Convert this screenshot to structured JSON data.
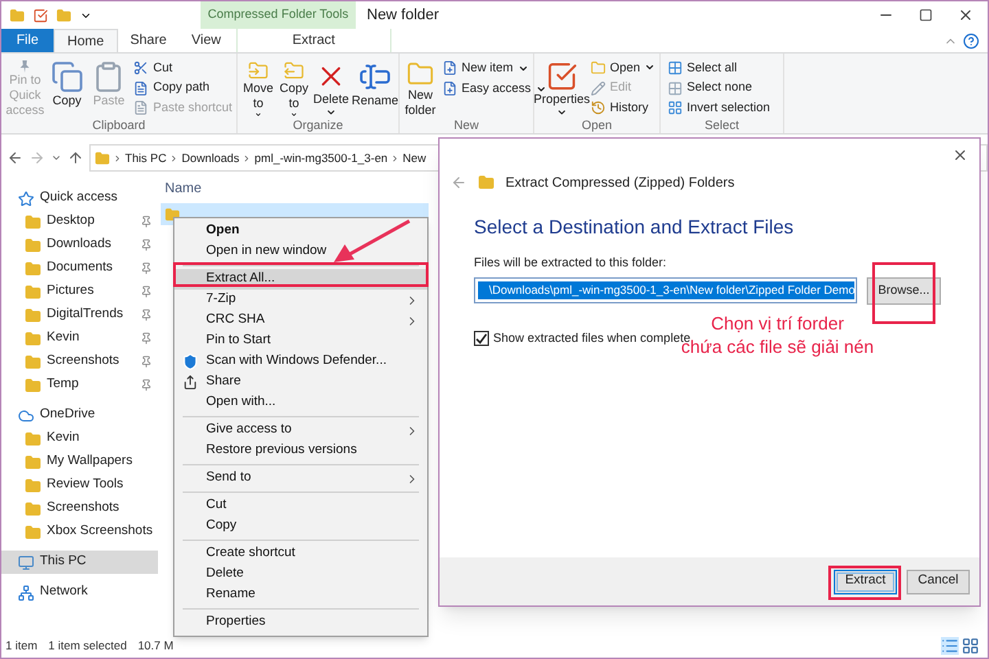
{
  "window": {
    "title": "New folder",
    "context_tab_group": "Compressed Folder Tools"
  },
  "ribbon_tabs": [
    {
      "label": "File",
      "kind": "file",
      "selected": false
    },
    {
      "label": "Home",
      "kind": "tab",
      "selected": true
    },
    {
      "label": "Share",
      "kind": "tab",
      "selected": false
    },
    {
      "label": "View",
      "kind": "tab",
      "selected": false
    },
    {
      "label": "Extract",
      "kind": "context",
      "selected": false
    }
  ],
  "ribbon_groups": [
    {
      "label": "Clipboard",
      "commands": [
        {
          "label": "Pin to Quick access",
          "kind": "large",
          "disabled": true,
          "dropdown": false
        },
        {
          "label": "Copy",
          "kind": "large",
          "disabled": false,
          "dropdown": false
        },
        {
          "label": "Paste",
          "kind": "large",
          "disabled": true,
          "dropdown": false
        },
        {
          "label": "Cut",
          "kind": "small",
          "disabled": false,
          "dropdown": false
        },
        {
          "label": "Copy path",
          "kind": "small",
          "disabled": false,
          "dropdown": false
        },
        {
          "label": "Paste shortcut",
          "kind": "small",
          "disabled": true,
          "dropdown": false
        }
      ]
    },
    {
      "label": "Organize",
      "commands": [
        {
          "label": "Move to",
          "kind": "large",
          "disabled": false,
          "dropdown": true
        },
        {
          "label": "Copy to",
          "kind": "large",
          "disabled": false,
          "dropdown": true
        },
        {
          "label": "Delete",
          "kind": "large",
          "disabled": false,
          "dropdown": true
        },
        {
          "label": "Rename",
          "kind": "large",
          "disabled": false,
          "dropdown": false
        }
      ]
    },
    {
      "label": "New",
      "commands": [
        {
          "label": "New folder",
          "kind": "large",
          "disabled": false,
          "dropdown": false
        },
        {
          "label": "New item",
          "kind": "small",
          "disabled": false,
          "dropdown": true
        },
        {
          "label": "Easy access",
          "kind": "small",
          "disabled": false,
          "dropdown": true
        }
      ]
    },
    {
      "label": "Open",
      "commands": [
        {
          "label": "Properties",
          "kind": "large",
          "disabled": false,
          "dropdown": true
        },
        {
          "label": "Open",
          "kind": "small",
          "disabled": false,
          "dropdown": true
        },
        {
          "label": "Edit",
          "kind": "small",
          "disabled": true,
          "dropdown": false
        },
        {
          "label": "History",
          "kind": "small",
          "disabled": false,
          "dropdown": false
        }
      ]
    },
    {
      "label": "Select",
      "commands": [
        {
          "label": "Select all",
          "kind": "small",
          "disabled": false,
          "dropdown": false
        },
        {
          "label": "Select none",
          "kind": "small",
          "disabled": false,
          "dropdown": false
        },
        {
          "label": "Invert selection",
          "kind": "small",
          "disabled": false,
          "dropdown": false
        }
      ]
    }
  ],
  "address": {
    "breadcrumbs": [
      "This PC",
      "Downloads",
      "pml_-win-mg3500-1_3-en",
      "New"
    ]
  },
  "nav": [
    {
      "label": "Quick access",
      "kind": "star",
      "selected": false,
      "children": [
        {
          "label": "Desktop",
          "pinned": true,
          "selected": false
        },
        {
          "label": "Downloads",
          "pinned": true,
          "selected": false
        },
        {
          "label": "Documents",
          "pinned": true,
          "selected": false
        },
        {
          "label": "Pictures",
          "pinned": true,
          "selected": false
        },
        {
          "label": "DigitalTrends",
          "pinned": true,
          "selected": false
        },
        {
          "label": "Kevin",
          "pinned": true,
          "selected": false
        },
        {
          "label": "Screenshots",
          "pinned": true,
          "selected": false
        },
        {
          "label": "Temp",
          "pinned": true,
          "selected": false
        }
      ]
    },
    {
      "label": "OneDrive",
      "kind": "cloud",
      "selected": false,
      "children": [
        {
          "label": "Kevin",
          "pinned": false,
          "selected": false
        },
        {
          "label": "My Wallpapers",
          "pinned": false,
          "selected": false
        },
        {
          "label": "Review Tools",
          "pinned": false,
          "selected": false
        },
        {
          "label": "Screenshots",
          "pinned": false,
          "selected": false
        },
        {
          "label": "Xbox Screenshots",
          "pinned": false,
          "selected": false
        }
      ]
    },
    {
      "label": "This PC",
      "kind": "pc",
      "selected": true
    },
    {
      "label": "Network",
      "kind": "network",
      "selected": false
    }
  ],
  "file_list": {
    "columns": [
      "Name"
    ],
    "rows": [
      {
        "selected": true
      }
    ]
  },
  "context_menu": [
    [
      {
        "label": "Open",
        "kind": "text",
        "bold": true,
        "selected": false,
        "submenu": false
      },
      {
        "label": "Open in new window",
        "kind": "text",
        "bold": false,
        "selected": false,
        "submenu": false
      }
    ],
    [
      {
        "label": "Extract All...",
        "kind": "text",
        "bold": false,
        "selected": true,
        "submenu": false
      },
      {
        "label": "7-Zip",
        "kind": "text",
        "bold": false,
        "selected": false,
        "submenu": true
      },
      {
        "label": "CRC SHA",
        "kind": "text",
        "bold": false,
        "selected": false,
        "submenu": true
      },
      {
        "label": "Pin to Start",
        "kind": "text",
        "bold": false,
        "selected": false,
        "submenu": false
      },
      {
        "label": "Scan with Windows Defender...",
        "kind": "shield",
        "bold": false,
        "selected": false,
        "submenu": false
      },
      {
        "label": "Share",
        "kind": "share",
        "bold": false,
        "selected": false,
        "submenu": false
      },
      {
        "label": "Open with...",
        "kind": "text",
        "bold": false,
        "selected": false,
        "submenu": false
      }
    ],
    [
      {
        "label": "Give access to",
        "kind": "text",
        "bold": false,
        "selected": false,
        "submenu": true
      },
      {
        "label": "Restore previous versions",
        "kind": "text",
        "bold": false,
        "selected": false,
        "submenu": false
      }
    ],
    [
      {
        "label": "Send to",
        "kind": "text",
        "bold": false,
        "selected": false,
        "submenu": true
      }
    ],
    [
      {
        "label": "Cut",
        "kind": "text",
        "bold": false,
        "selected": false,
        "submenu": false
      },
      {
        "label": "Copy",
        "kind": "text",
        "bold": false,
        "selected": false,
        "submenu": false
      }
    ],
    [
      {
        "label": "Create shortcut",
        "kind": "text",
        "bold": false,
        "selected": false,
        "submenu": false
      },
      {
        "label": "Delete",
        "kind": "text",
        "bold": false,
        "selected": false,
        "submenu": false
      },
      {
        "label": "Rename",
        "kind": "text",
        "bold": false,
        "selected": false,
        "submenu": false
      }
    ],
    [
      {
        "label": "Properties",
        "kind": "text",
        "bold": false,
        "selected": false,
        "submenu": false
      }
    ]
  ],
  "dialog": {
    "title": "Extract Compressed (Zipped) Folders",
    "heading": "Select a Destination and Extract Files",
    "field_label": "Files will be extracted to this folder:",
    "path": {
      "value": "\\Downloads\\pml_-win-mg3500-1_3-en\\New folder\\Zipped Folder Demo",
      "selected": true
    },
    "browse": "Browse...",
    "checkbox": {
      "label": "Show extracted files when complete",
      "checked": true
    },
    "buttons": [
      {
        "label": "Extract",
        "default": true
      },
      {
        "label": "Cancel",
        "default": false
      }
    ]
  },
  "annotation": {
    "note": [
      "Chọn vị trí forder",
      "chứa các file sẽ giải nén"
    ]
  },
  "status_bar": [
    "1 item",
    "1 item selected",
    "10.7 M"
  ]
}
